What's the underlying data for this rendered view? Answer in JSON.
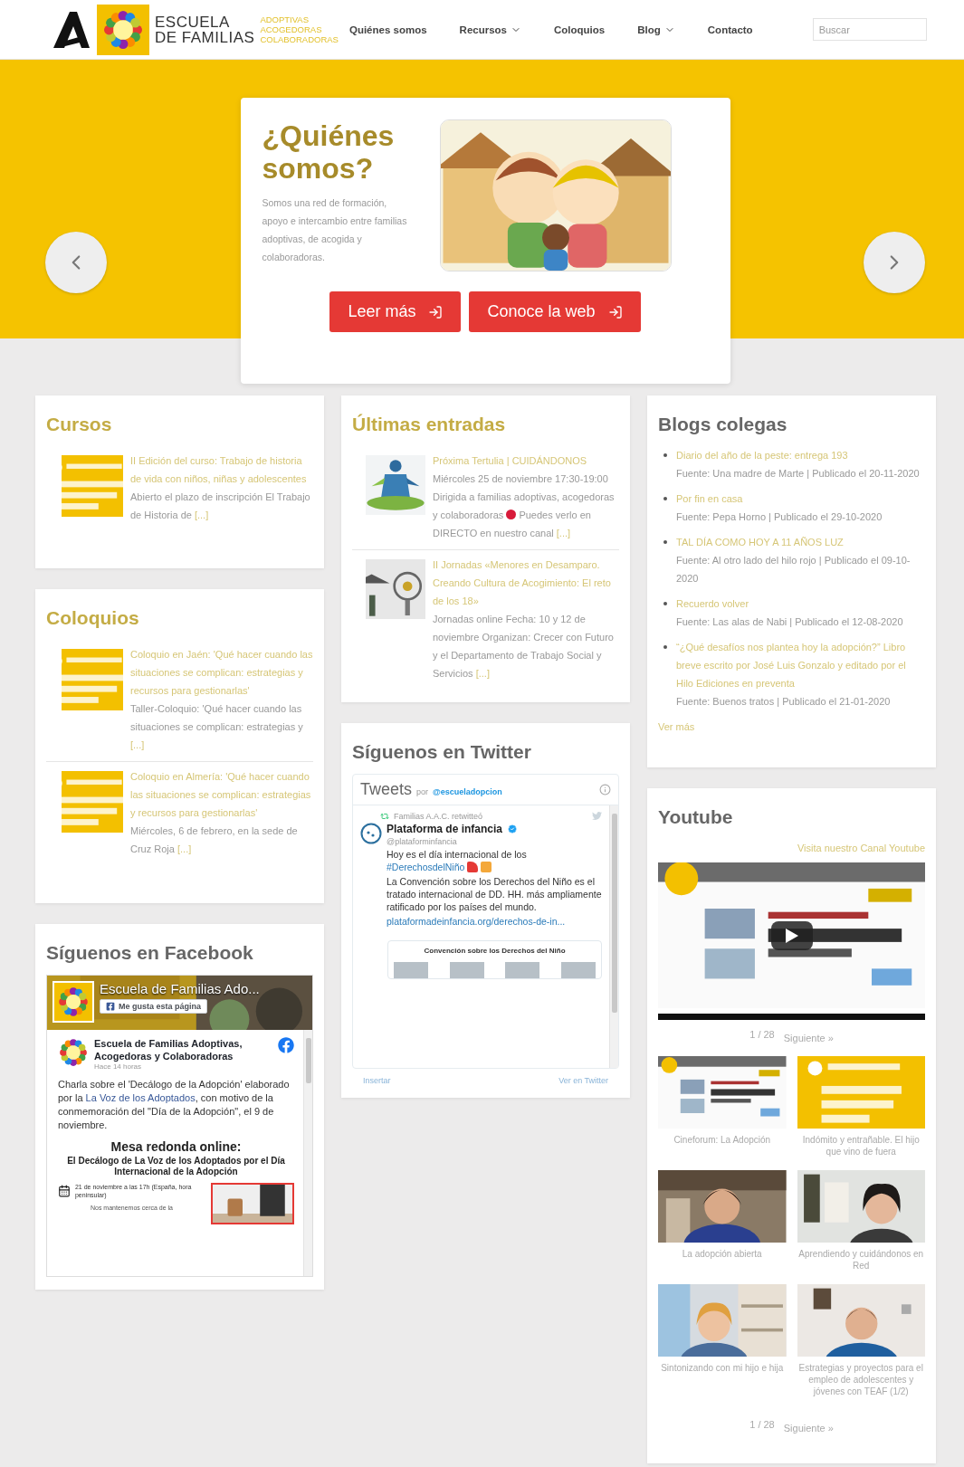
{
  "header": {
    "logo": {
      "title": [
        "ESCUELA",
        "DE FAMILIAS"
      ],
      "subtitle": [
        "ADOPTIVAS",
        "ACOGEDORAS",
        "COLABORADORAS"
      ]
    },
    "nav": [
      {
        "label": "Quiénes somos",
        "dropdown": false
      },
      {
        "label": "Recursos",
        "dropdown": true
      },
      {
        "label": "Coloquios",
        "dropdown": false
      },
      {
        "label": "Blog",
        "dropdown": true
      },
      {
        "label": "Contacto",
        "dropdown": false
      }
    ],
    "search": {
      "placeholder": "Buscar"
    }
  },
  "hero": {
    "title": "¿Quiénes somos?",
    "text": "Somos una red de formación, apoyo e intercambio entre familias adoptivas, de acogida y colaboradoras.",
    "buttons": [
      "Leer más",
      "Conoce la web"
    ]
  },
  "cursos": {
    "title": "Cursos",
    "posts": [
      {
        "title": "II Edición del curso: Trabajo de historia de vida con niños, niñas y adolescentes",
        "excerpt": "Abierto el plazo de inscripción El Trabajo de Historia de",
        "more": "[...]"
      }
    ]
  },
  "coloquios": {
    "title": "Coloquios",
    "posts": [
      {
        "title": "Coloquio en Jaén: 'Qué hacer cuando las situaciones se complican: estrategias y recursos para gestionarlas'",
        "excerpt": "Taller-Coloquio: 'Qué hacer cuando las situaciones se complican: estrategias y",
        "more": "[...]"
      },
      {
        "title": "Coloquio en Almería: 'Qué hacer cuando las situaciones se complican: estrategias y recursos para gestionarlas'",
        "excerpt": "Miércoles, 6 de febrero, en la sede de Cruz Roja",
        "more": "[...]"
      }
    ]
  },
  "facebook": {
    "title": "Síguenos en Facebook",
    "page_name": "Escuela de Familias Ado...",
    "like_button": "Me gusta esta página",
    "post": {
      "author": "Escuela de Familias Adoptivas, Acogedoras y Colaboradoras",
      "time": "Hace 14 horas",
      "text": "Charla sobre el 'Decálogo de la Adopción' elaborado por la",
      "link": "La Voz de los Adoptados",
      "text_after": ", con motivo de la conmemoración del \"Día de la Adopción\", el 9 de noviembre.",
      "poster": {
        "title": "Mesa redonda online:",
        "subtitle": "El Decálogo de La Voz de los Adoptados por el Día Internacional de la Adopción",
        "date": "21 de noviembre a las 17h (España, hora peninsular)",
        "footer": "Nos mantenemos cerca de la"
      }
    }
  },
  "ultimas": {
    "title": "Últimas entradas",
    "posts": [
      {
        "title": "Próxima Tertulia | CUIDÁNDONOS",
        "excerpt": "Miércoles 25 de noviembre 17:30-19:00 Dirigida a familias adoptivas, acogedoras y colaboradoras",
        "live_dot": true,
        "excerpt_more": "Puedes verlo en DIRECTO en nuestro canal",
        "more": "[...]"
      },
      {
        "title": "II Jornadas «Menores en Desamparo. Creando Cultura de Acogimiento: El reto de los 18»",
        "excerpt": "Jornadas online Fecha: 10 y 12 de noviembre Organizan: Crecer con Futuro y el Departamento de Trabajo Social y Servicios",
        "live_dot": false,
        "more": "[...]"
      }
    ]
  },
  "twitter": {
    "title": "Síguenos en Twitter",
    "header": {
      "label": "Tweets",
      "by": "por",
      "handle": "@escueladopcion"
    },
    "tweet": {
      "retweeted_by": "Familias A.A.C. retwitteó",
      "name": "Plataforma de infancia",
      "verified": true,
      "handle": "@plataforminfancia",
      "text": "Hoy es el día internacional de los",
      "hashtag": "#DerechosdelNiño",
      "body": "La Convención sobre los Derechos del Niño es el tratado internacional de DD. HH. más ampliamente ratificado por los países del mundo.",
      "link": "plataformadeinfancia.org/derechos-de-in...",
      "card_title": "Convención sobre los Derechos del Niño"
    },
    "footer": [
      "Insertar",
      "Ver en Twitter"
    ]
  },
  "blogs": {
    "title": "Blogs colegas",
    "items": [
      {
        "title": "Diario del año de la peste: entrega 193",
        "meta": "Fuente: Una madre de Marte | Publicado el 20-11-2020"
      },
      {
        "title": "Por fin en casa",
        "meta": "Fuente: Pepa Horno | Publicado el 29-10-2020"
      },
      {
        "title": "TAL DÍA COMO HOY A 11 AÑOS LUZ",
        "meta": "Fuente: Al otro lado del hilo rojo | Publicado el 09-10-2020"
      },
      {
        "title": "Recuerdo volver",
        "meta": "Fuente: Las alas de Nabi | Publicado el 12-08-2020"
      },
      {
        "title": "“¿Qué desafíos nos plantea hoy la adopción?” Libro breve escrito por José Luis Gonzalo y editado por el Hilo Ediciones en preventa",
        "meta": "Fuente: Buenos tratos | Publicado el 21-01-2020"
      }
    ],
    "more": "Ver más"
  },
  "youtube": {
    "title": "Youtube",
    "channel_link": "Visita nuestro Canal Youtube",
    "pager_top": {
      "page": "1 / 28",
      "next": "Siguiente »"
    },
    "videos": [
      "Cineforum: La Adopción",
      "Indómito y entrañable. El hijo que vino de fuera",
      "La adopción abierta",
      "Aprendiendo y cuidándonos en Red",
      "Sintonizando con mi hijo e hija",
      "Estrategias y proyectos para el empleo de adolescentes y jóvenes con TEAF (1/2)"
    ],
    "pager_bottom": {
      "page": "1 / 28",
      "next": "Siguiente »"
    }
  }
}
